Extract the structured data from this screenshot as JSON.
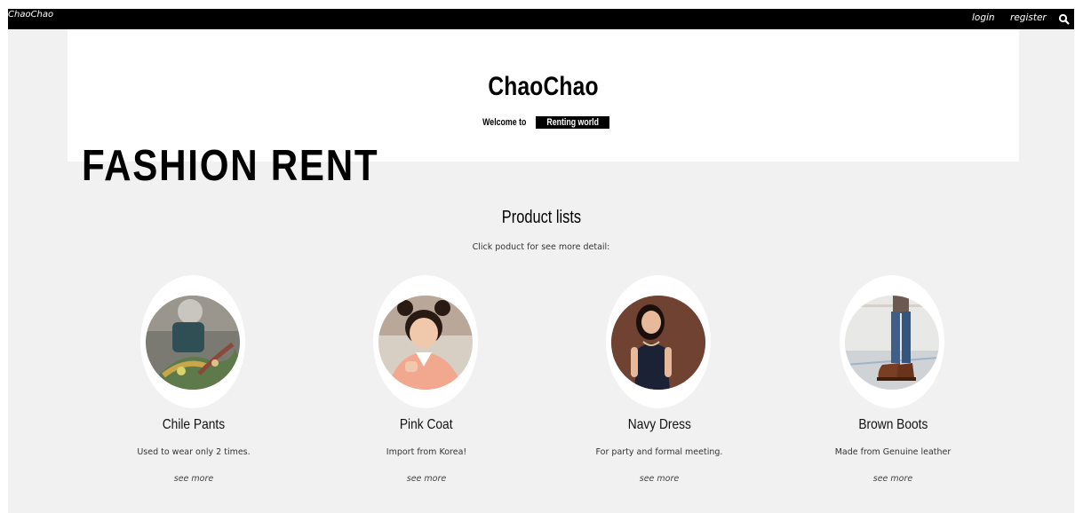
{
  "nav": {
    "brand": "ChaoChao",
    "login": "login",
    "register": "register",
    "search_icon": "search-icon"
  },
  "hero": {
    "title": "ChaoChao",
    "welcome_prefix": "Welcome to",
    "welcome_tag": "Renting world"
  },
  "banner": "FASHION RENT",
  "products_section": {
    "title": "Product lists",
    "subtitle": "Click poduct for see more detail:"
  },
  "products": [
    {
      "name": "Chile Pants",
      "description": "Used to wear only 2 times.",
      "link": "see more"
    },
    {
      "name": "Pink Coat",
      "description": "Import from Korea!",
      "link": "see more"
    },
    {
      "name": "Navy Dress",
      "description": "For party and formal meeting.",
      "link": "see more"
    },
    {
      "name": "Brown Boots",
      "description": "Made from Genuine leather",
      "link": "see more"
    }
  ],
  "colors": {
    "topbar": "#000000",
    "page_bg": "#f1f1f1",
    "hero_bg": "#ffffff"
  }
}
